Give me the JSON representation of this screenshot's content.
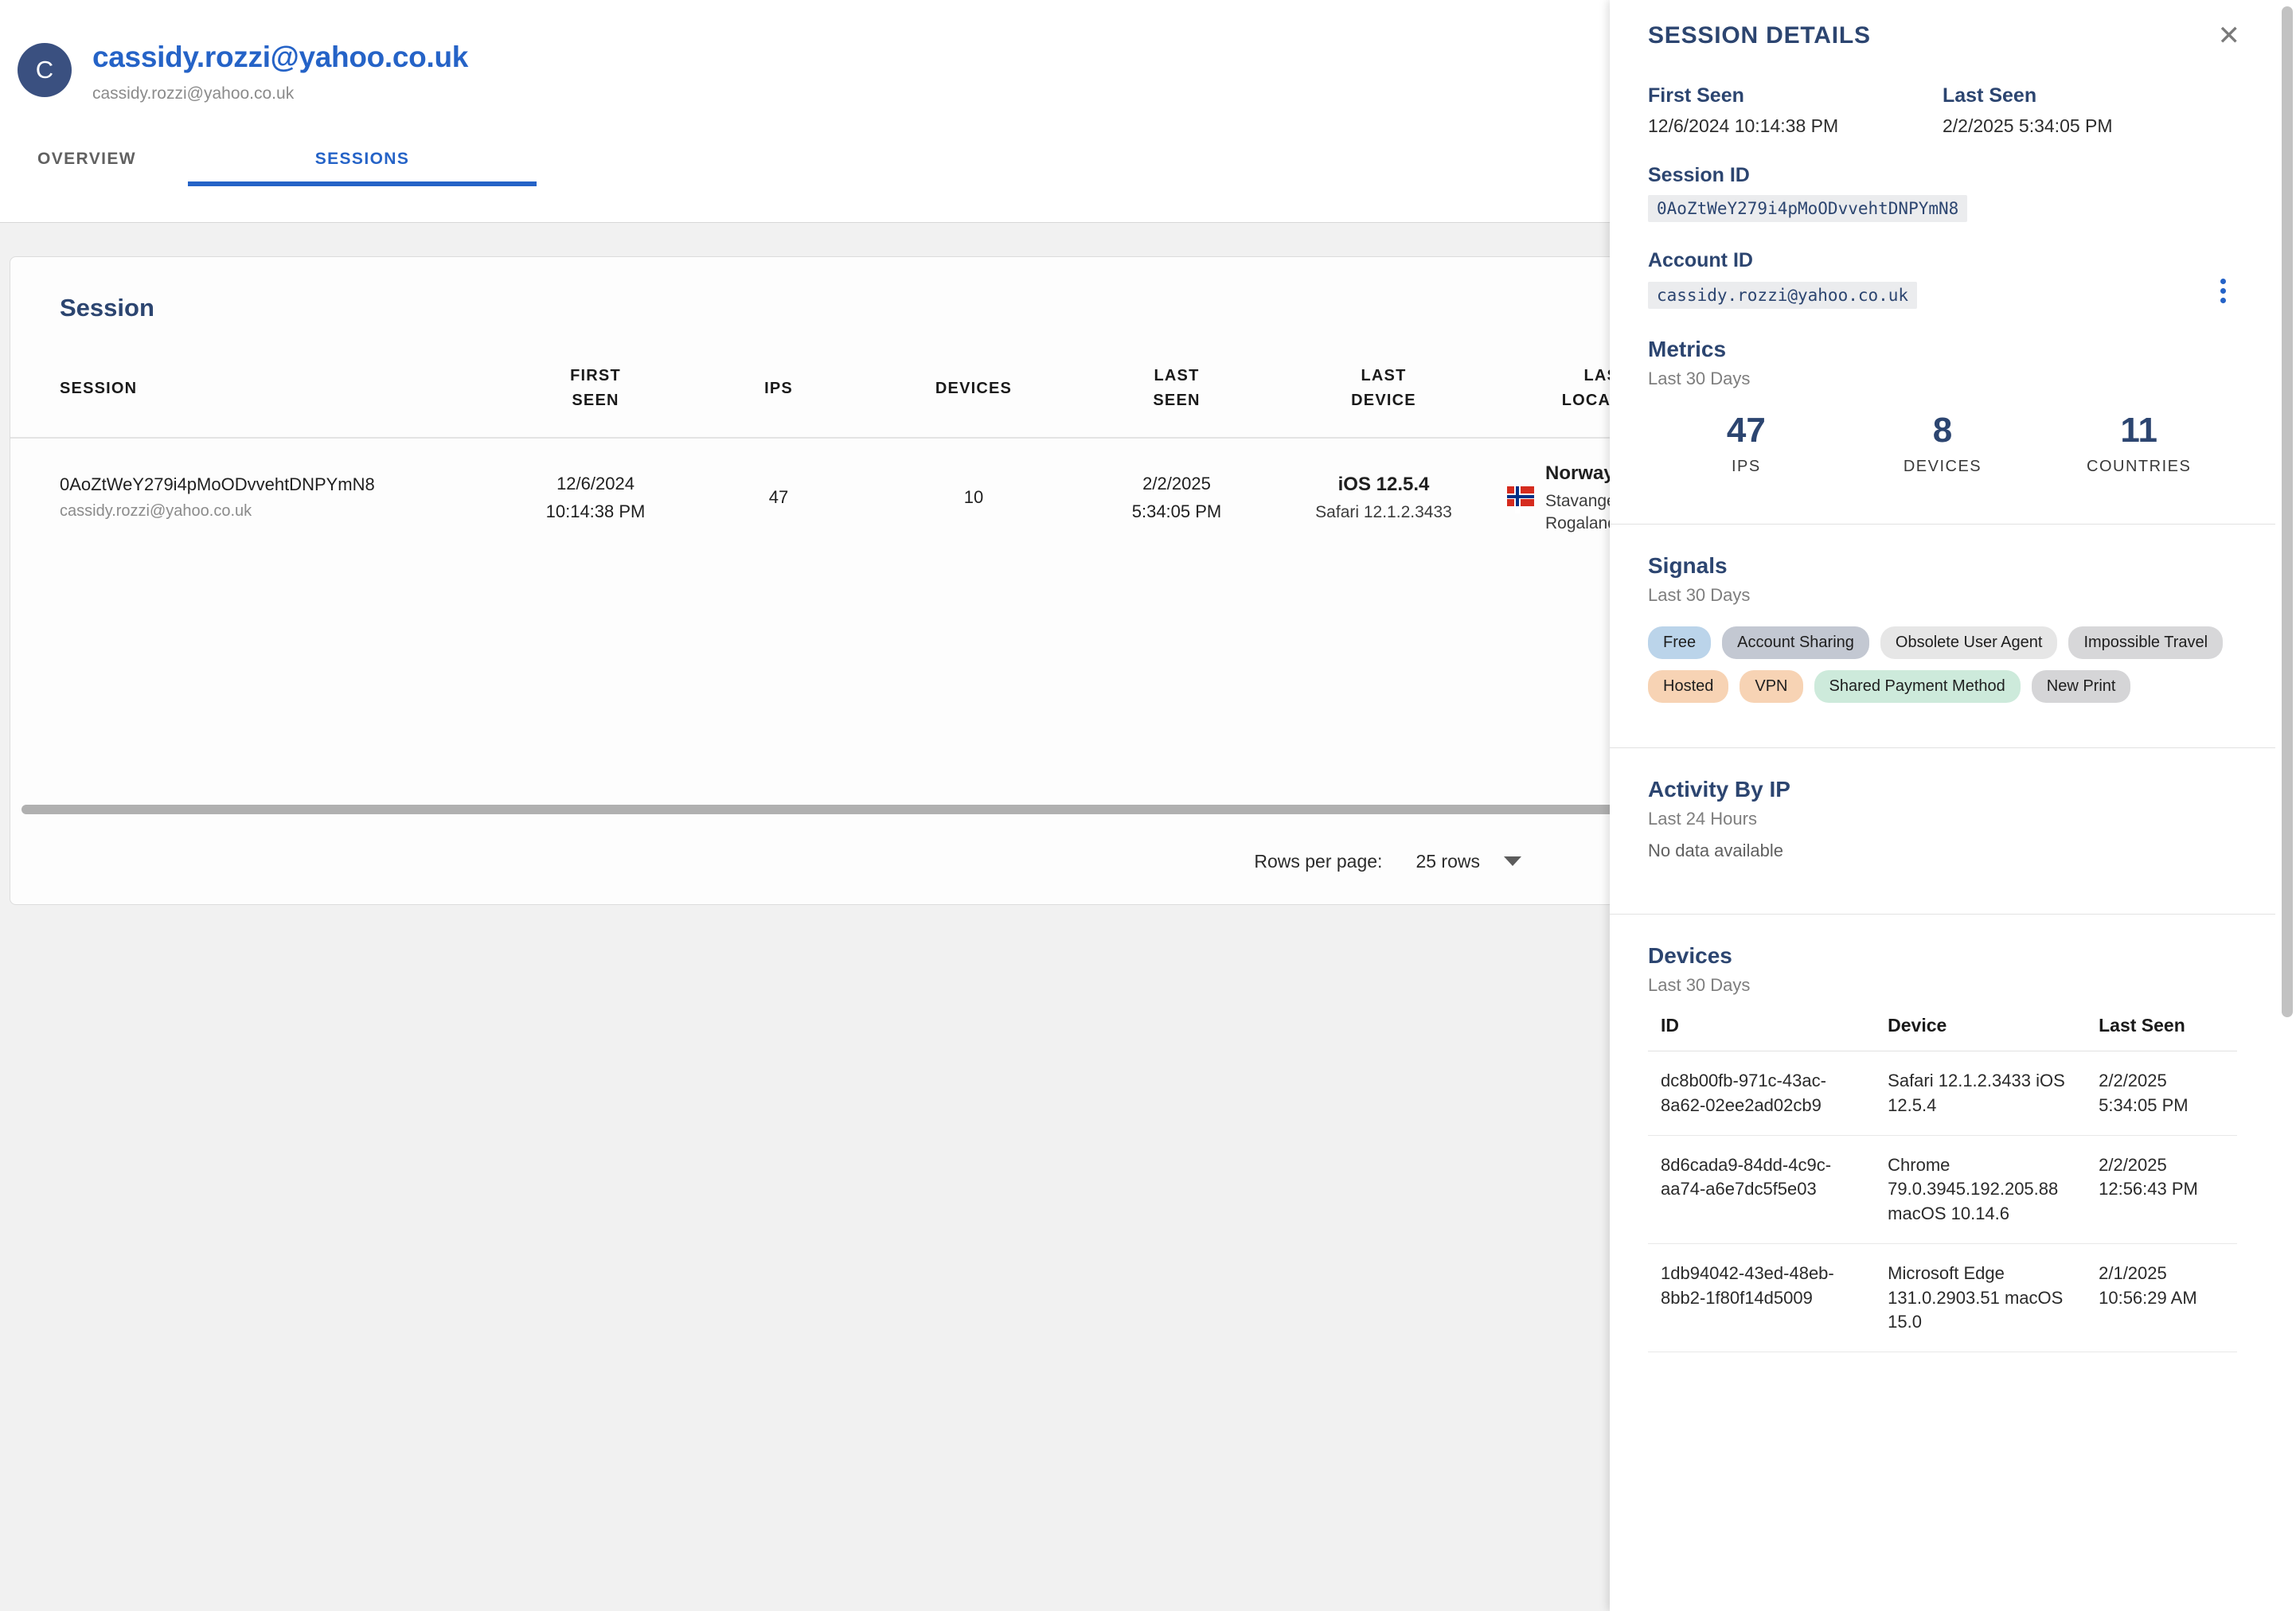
{
  "profile": {
    "avatar_initial": "C",
    "title": "cassidy.rozzi@yahoo.co.uk",
    "subtitle": "cassidy.rozzi@yahoo.co.uk"
  },
  "tabs": [
    {
      "label": "OVERVIEW",
      "selected": false
    },
    {
      "label": "SESSIONS",
      "selected": true
    }
  ],
  "session_card": {
    "title": "Session",
    "columns": [
      "SESSION",
      "FIRST SEEN",
      "IPS",
      "DEVICES",
      "LAST SEEN",
      "LAST DEVICE",
      "LAST LOCATION"
    ],
    "rows": [
      {
        "session_id": "0AoZtWeY279i4pMoODvvehtDNPYmN8",
        "account": "cassidy.rozzi@yahoo.co.uk",
        "first_seen_date": "12/6/2024",
        "first_seen_time": "10:14:38 PM",
        "ips": "47",
        "devices": "10",
        "last_seen_date": "2/2/2025",
        "last_seen_time": "5:34:05 PM",
        "last_device_os": "iOS 12.5.4",
        "last_device_browser": "Safari 12.1.2.3433",
        "last_location_country": "Norway",
        "last_location_city": "Stavanger",
        "last_location_region": "Rogaland",
        "flag_icon": "norway-flag-icon"
      }
    ],
    "pagination": {
      "rows_per_page_label": "Rows per page:",
      "rows_per_page_value": "25 rows"
    }
  },
  "panel": {
    "title": "SESSION DETAILS",
    "close_icon": "close-icon",
    "first_seen_label": "First Seen",
    "first_seen_value": "12/6/2024 10:14:38 PM",
    "last_seen_label": "Last Seen",
    "last_seen_value": "2/2/2025 5:34:05 PM",
    "session_id_label": "Session ID",
    "session_id_value": "0AoZtWeY279i4pMoODvvehtDNPYmN8",
    "account_id_label": "Account ID",
    "account_id_value": "cassidy.rozzi@yahoo.co.uk",
    "kebab_icon": "more-options-icon",
    "metrics": {
      "title": "Metrics",
      "subtitle": "Last 30 Days",
      "items": [
        {
          "value": "47",
          "label": "IPS"
        },
        {
          "value": "8",
          "label": "DEVICES"
        },
        {
          "value": "11",
          "label": "COUNTRIES"
        }
      ]
    },
    "signals": {
      "title": "Signals",
      "subtitle": "Last 30 Days",
      "chips": [
        {
          "label": "Free",
          "color": "#bbd4ea"
        },
        {
          "label": "Account Sharing",
          "color": "#c3c8d2"
        },
        {
          "label": "Obsolete User Agent",
          "color": "#e6e6e6"
        },
        {
          "label": "Impossible Travel",
          "color": "#d7d7d9"
        },
        {
          "label": "Hosted",
          "color": "#f7d3b4"
        },
        {
          "label": "VPN",
          "color": "#f7d3b4"
        },
        {
          "label": "Shared Payment Method",
          "color": "#cdeadb"
        },
        {
          "label": "New Print",
          "color": "#d5d5d7"
        }
      ]
    },
    "activity_by_ip": {
      "title": "Activity By IP",
      "subtitle": "Last 24 Hours",
      "empty_message": "No data available"
    },
    "devices": {
      "title": "Devices",
      "subtitle": "Last 30 Days",
      "columns": [
        "ID",
        "Device",
        "Last Seen"
      ],
      "rows": [
        {
          "id": "dc8b00fb-971c-43ac-8a62-02ee2ad02cb9",
          "device": "Safari 12.1.2.3433 iOS 12.5.4",
          "last_seen": "2/2/2025 5:34:05 PM"
        },
        {
          "id": "8d6cada9-84dd-4c9c-aa74-a6e7dc5f5e03",
          "device": "Chrome 79.0.3945.192.205.88 macOS 10.14.6",
          "last_seen": "2/2/2025 12:56:43 PM"
        },
        {
          "id": "1db94042-43ed-48eb-8bb2-1f80f14d5009",
          "device": "Microsoft Edge 131.0.2903.51 macOS 15.0",
          "last_seen": "2/1/2025 10:56:29 AM"
        }
      ]
    }
  }
}
